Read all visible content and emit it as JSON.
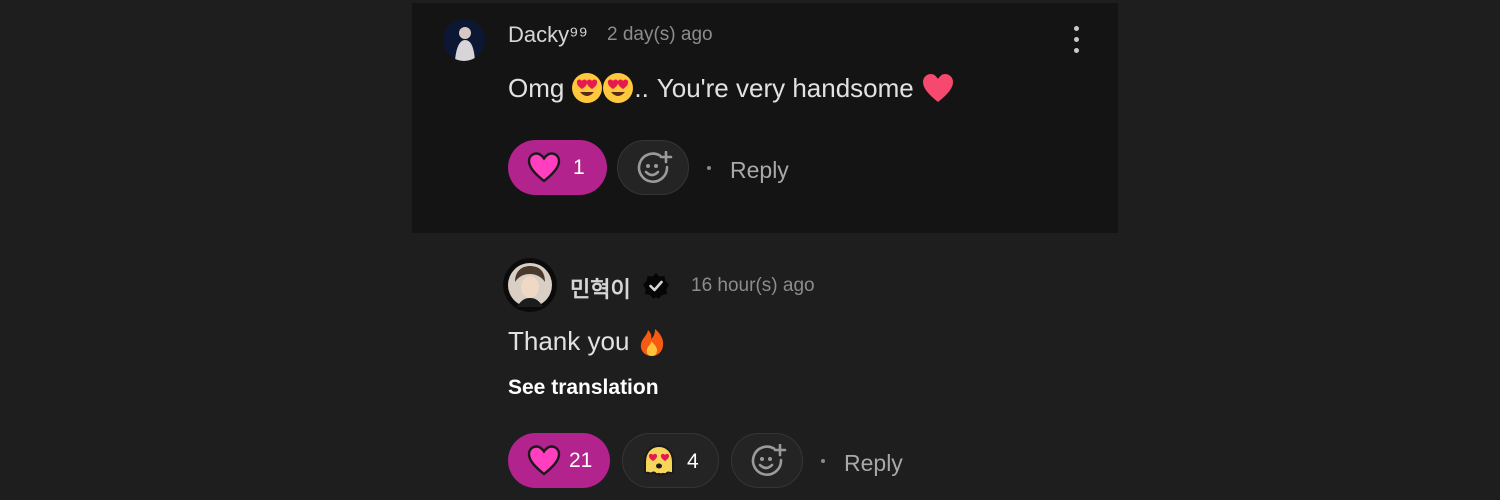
{
  "comment": {
    "author": "Dacky⁹⁹",
    "timestamp": "2 day(s) ago",
    "text_before": "Omg",
    "text_middle": "..",
    "text_after": "You're very handsome",
    "like_count": "1",
    "reply_label": "Reply",
    "more_icon": "more-vertical-icon"
  },
  "reply": {
    "author": "민혁이",
    "verified": true,
    "timestamp": "16 hour(s) ago",
    "text": "Thank you",
    "translate_label": "See translation",
    "like_count": "21",
    "ghost_reaction_count": "4",
    "reply_label": "Reply"
  },
  "colors": {
    "background": "#1e1e1e",
    "highlight_panel": "#141414",
    "like_pill": "#b2238e",
    "heart": "#ff3fc0"
  }
}
